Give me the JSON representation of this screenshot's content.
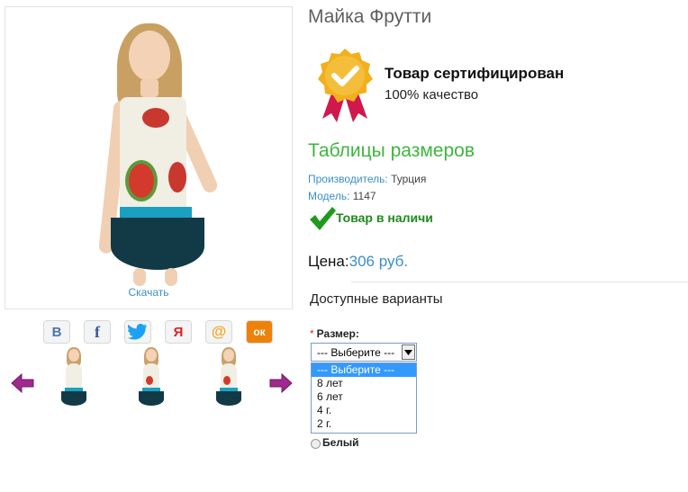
{
  "product": {
    "title": "Майка Фрутти",
    "download_label": "Скачать"
  },
  "certificate": {
    "line1": "Товар сертифицирован",
    "line2": "100% качество"
  },
  "sizes_link": "Таблицы размеров",
  "meta": {
    "manufacturer_key": "Производитель:",
    "manufacturer_value": "Турция",
    "model_key": "Модель:",
    "model_value": "1147"
  },
  "stock": "Товар в наличи",
  "price": {
    "label": "Цена:",
    "value": "306 руб."
  },
  "variants_title": "Доступные варианты",
  "size": {
    "required_mark": "*",
    "label": "Размер:",
    "selected": "--- Выберите ---",
    "options": [
      "--- Выберите ---",
      "8 лет",
      "6 лет",
      "4 г.",
      "2 г."
    ]
  },
  "color_option": "Белый",
  "social": [
    {
      "icon": "vk-icon",
      "glyph": "В",
      "color": "#4a76a8"
    },
    {
      "icon": "facebook-icon",
      "glyph": "f",
      "color": "#3b5998"
    },
    {
      "icon": "twitter-icon",
      "glyph": "🐦",
      "color": "#1da1f2"
    },
    {
      "icon": "yandex-icon",
      "glyph": "Я",
      "color": "#e02020"
    },
    {
      "icon": "mail-icon",
      "glyph": "@",
      "color": "#f5a623"
    },
    {
      "icon": "odnoklassniki-icon",
      "glyph": "ок",
      "color": "#ee8208"
    }
  ],
  "colors": {
    "accent_green": "#3fb53f",
    "link_blue": "#3a8fc9",
    "arrow_purple": "#a0298f",
    "badge_gold": "#f2b01e",
    "ribbon_red": "#d0184c"
  }
}
